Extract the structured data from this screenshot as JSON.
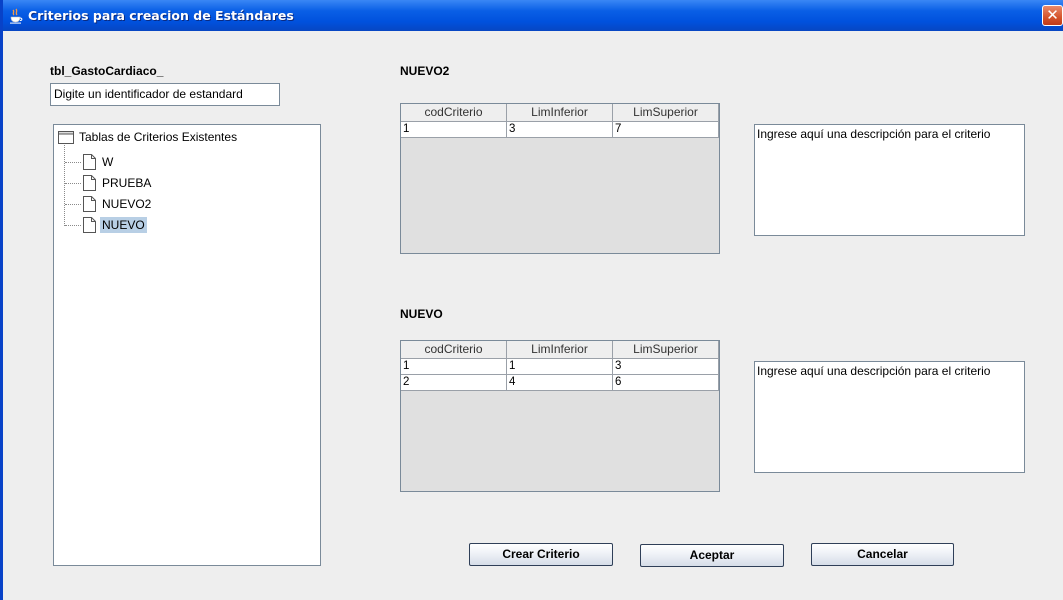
{
  "window": {
    "title": "Criterios para creacion de Estándares",
    "close_glyph": "✕"
  },
  "left": {
    "table_name": "tbl_GastoCardiaco_",
    "identifier_placeholder": "Digite un identificador de estandard",
    "tree": {
      "root_label": "Tablas de Criterios Existentes",
      "items": [
        {
          "label": "W",
          "selected": false
        },
        {
          "label": "PRUEBA",
          "selected": false
        },
        {
          "label": "NUEVO2",
          "selected": false
        },
        {
          "label": "NUEVO",
          "selected": true
        }
      ]
    }
  },
  "sections": [
    {
      "title": "NUEVO2",
      "columns": [
        "codCriterio",
        "LimInferior",
        "LimSuperior"
      ],
      "rows": [
        [
          "1",
          "3",
          "7"
        ]
      ],
      "description": "Ingrese aquí una descripción para el criterio"
    },
    {
      "title": "NUEVO",
      "columns": [
        "codCriterio",
        "LimInferior",
        "LimSuperior"
      ],
      "rows": [
        [
          "1",
          "1",
          "3"
        ],
        [
          "2",
          "4",
          "6"
        ]
      ],
      "description": "Ingrese aquí una descripción para el criterio"
    }
  ],
  "buttons": {
    "crear": "Crear Criterio",
    "aceptar": "Aceptar",
    "cancelar": "Cancelar"
  },
  "colors": {
    "titlebar": "#0a5fe6",
    "selection": "#b8cfe5",
    "close": "#d4532b"
  }
}
